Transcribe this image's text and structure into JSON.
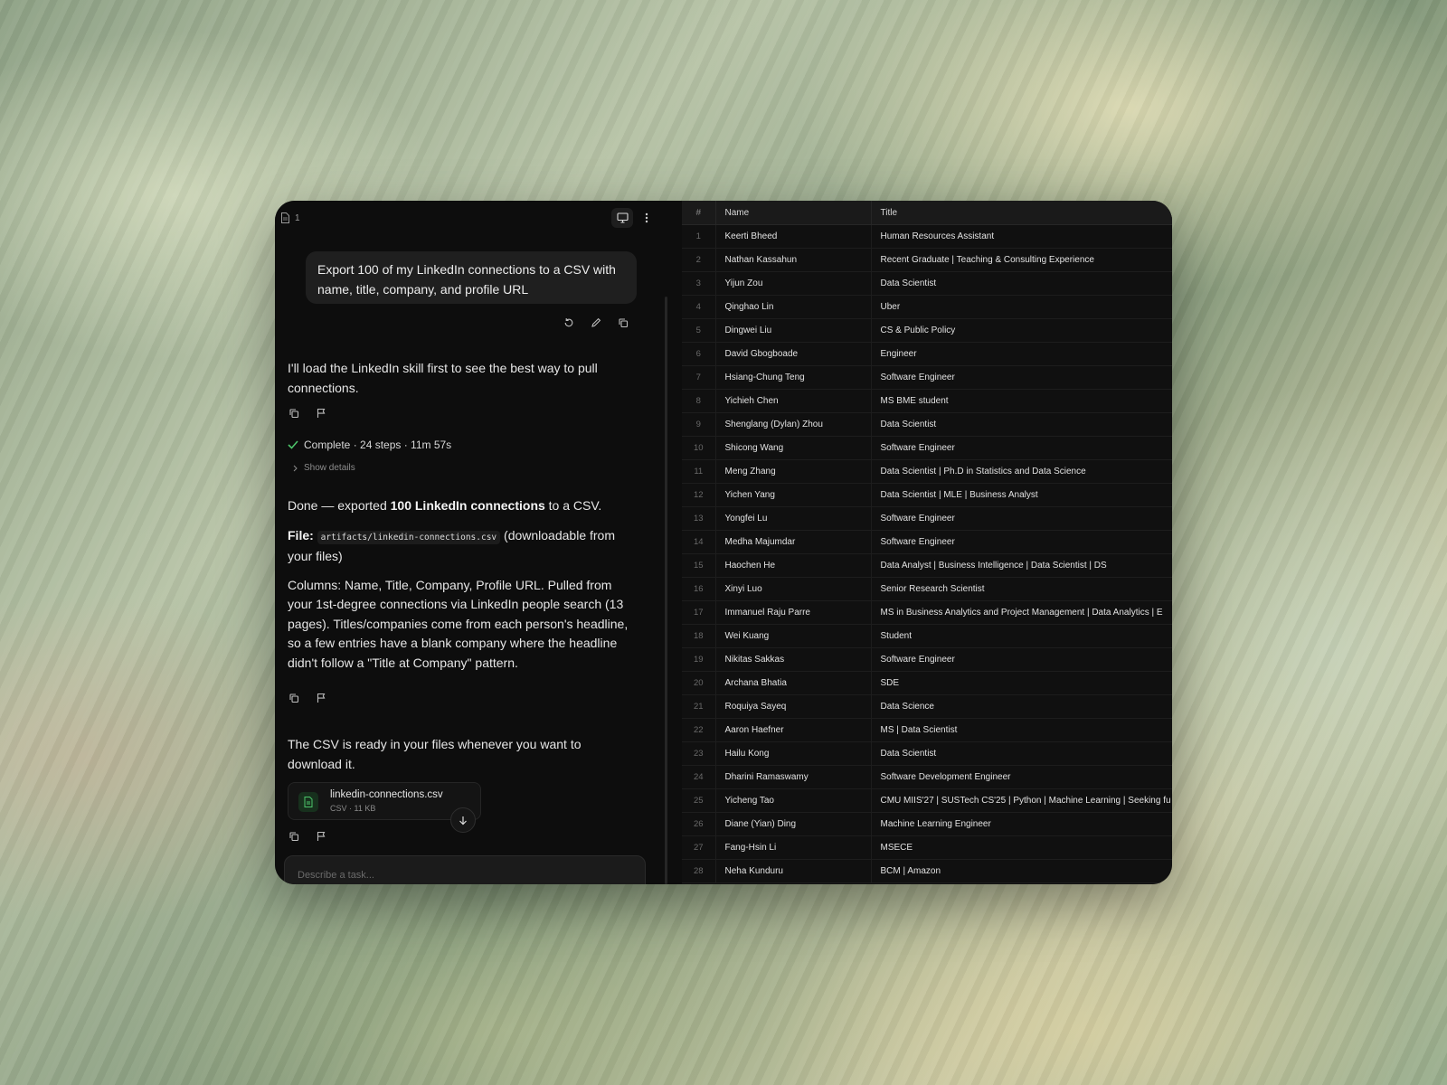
{
  "topbar": {
    "doc_count": "1",
    "icons": [
      "document-icon",
      "monitor-icon",
      "more-vertical-icon"
    ]
  },
  "chat": {
    "user_message": "Export 100 of my LinkedIn connections to a CSV with name, title, company, and profile URL",
    "assistant_intro": "I'll load the LinkedIn skill first to see the best way to pull connections.",
    "status": "Complete · 24 steps · 11m 57s",
    "show_details": "Show details",
    "done_prefix": "Done — exported ",
    "done_bold": "100 LinkedIn connections",
    "done_suffix": " to a CSV.",
    "file_label": "File:",
    "file_path": "artifacts/linkedin-connections.csv",
    "file_note": "(downloadable from your files)",
    "columns_text": "Columns: Name, Title, Company, Profile URL. Pulled from your 1st-degree connections via LinkedIn people search (13 pages). Titles/companies come from each person's headline, so a few entries have a blank company where the headline didn't follow a \"Title at Company\" pattern.",
    "ready_text": "The CSV is ready in your files whenever you want to download it.",
    "file_card": {
      "name": "linkedin-connections.csv",
      "meta": "CSV · 11 KB"
    },
    "composer_placeholder": "Describe a task..."
  },
  "colors": {
    "accent_green": "#4cc46a",
    "panel_bg": "#0d0d0d",
    "table_bg": "#101010"
  },
  "table": {
    "headers": {
      "num": "#",
      "name": "Name",
      "title": "Title"
    },
    "rows": [
      {
        "n": "1",
        "name": "Keerti Bheed",
        "title": "Human Resources Assistant"
      },
      {
        "n": "2",
        "name": "Nathan Kassahun",
        "title": "Recent Graduate | Teaching & Consulting Experience"
      },
      {
        "n": "3",
        "name": "Yijun Zou",
        "title": "Data Scientist"
      },
      {
        "n": "4",
        "name": "Qinghao Lin",
        "title": "Uber"
      },
      {
        "n": "5",
        "name": "Dingwei Liu",
        "title": "CS & Public Policy"
      },
      {
        "n": "6",
        "name": "David Gbogboade",
        "title": "Engineer"
      },
      {
        "n": "7",
        "name": "Hsiang-Chung Teng",
        "title": "Software Engineer"
      },
      {
        "n": "8",
        "name": "Yichieh Chen",
        "title": "MS BME student"
      },
      {
        "n": "9",
        "name": "Shenglang (Dylan) Zhou",
        "title": "Data Scientist"
      },
      {
        "n": "10",
        "name": "Shicong Wang",
        "title": "Software Engineer"
      },
      {
        "n": "11",
        "name": "Meng Zhang",
        "title": "Data Scientist | Ph.D in Statistics and Data Science"
      },
      {
        "n": "12",
        "name": "Yichen Yang",
        "title": "Data Scientist | MLE | Business Analyst"
      },
      {
        "n": "13",
        "name": "Yongfei Lu",
        "title": "Software Engineer"
      },
      {
        "n": "14",
        "name": "Medha Majumdar",
        "title": "Software Engineer"
      },
      {
        "n": "15",
        "name": "Haochen He",
        "title": "Data Analyst | Business Intelligence | Data Scientist | DS"
      },
      {
        "n": "16",
        "name": "Xinyi Luo",
        "title": "Senior Research Scientist"
      },
      {
        "n": "17",
        "name": "Immanuel Raju Parre",
        "title": "MS in Business Analytics and Project Management | Data Analytics | E"
      },
      {
        "n": "18",
        "name": "Wei Kuang",
        "title": "Student"
      },
      {
        "n": "19",
        "name": "Nikitas Sakkas",
        "title": "Software Engineer"
      },
      {
        "n": "20",
        "name": "Archana Bhatia",
        "title": "SDE"
      },
      {
        "n": "21",
        "name": "Roquiya Sayeq",
        "title": "Data Science"
      },
      {
        "n": "22",
        "name": "Aaron Haefner",
        "title": "MS | Data Scientist"
      },
      {
        "n": "23",
        "name": "Hailu Kong",
        "title": "Data Scientist"
      },
      {
        "n": "24",
        "name": "Dharini Ramaswamy",
        "title": "Software Development Engineer"
      },
      {
        "n": "25",
        "name": "Yicheng Tao",
        "title": "CMU MIIS'27 | SUSTech CS'25 | Python | Machine Learning | Seeking fu"
      },
      {
        "n": "26",
        "name": "Diane (Yian) Ding",
        "title": "Machine Learning Engineer"
      },
      {
        "n": "27",
        "name": "Fang-Hsin Li",
        "title": "MSECE"
      },
      {
        "n": "28",
        "name": "Neha Kunduru",
        "title": "BCM | Amazon"
      }
    ]
  }
}
